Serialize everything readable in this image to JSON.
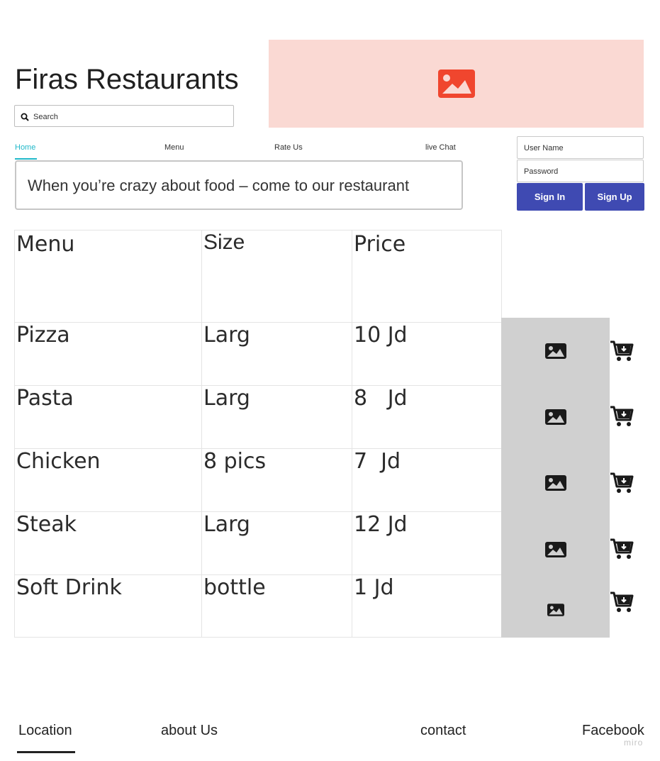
{
  "header": {
    "title": "Firas Restaurants",
    "search_placeholder": "Search",
    "banner_image": "image-placeholder-icon",
    "banner_color": "#fad9d3",
    "banner_icon_color": "#f0462e"
  },
  "nav": {
    "tabs": [
      {
        "label": "Home",
        "active": true
      },
      {
        "label": "Menu",
        "active": false
      },
      {
        "label": "Rate Us",
        "active": false
      },
      {
        "label": "live Chat",
        "active": false
      }
    ],
    "accent_color": "#21b8c9"
  },
  "tagline": "When you’re crazy about food – come to our restaurant",
  "login": {
    "username_placeholder": "User Name",
    "password_placeholder": "Password",
    "sign_in_label": "Sign In",
    "sign_up_label": "Sign Up",
    "button_color": "#3f4ab2"
  },
  "menu_table": {
    "columns": [
      "Menu",
      "Size",
      "Price"
    ],
    "rows": [
      {
        "item": "Pizza",
        "size": "Larg",
        "price": "10 Jd"
      },
      {
        "item": "Pasta",
        "size": "Larg",
        "price": "8   Jd"
      },
      {
        "item": "Chicken",
        "size": "8 pics",
        "price": "7  Jd"
      },
      {
        "item": "Steak",
        "size": "Larg",
        "price": "12 Jd"
      },
      {
        "item": "Soft Drink",
        "size": "bottle",
        "price": "1 Jd"
      }
    ],
    "row_icons": [
      "image-icon",
      "cart-download-icon"
    ]
  },
  "footer": {
    "links": [
      "Location",
      "about Us",
      "contact",
      "Facebook"
    ],
    "watermark": "miro"
  }
}
